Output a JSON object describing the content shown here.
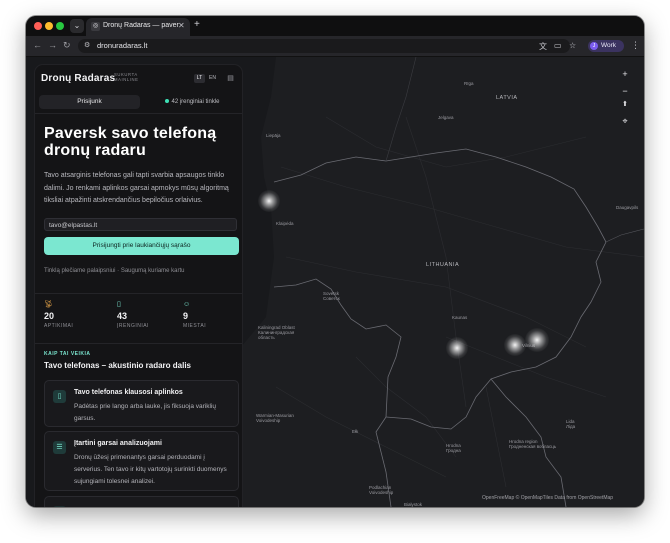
{
  "browser": {
    "tab_title": "Dronų Radaras — paversk sa...",
    "tab_favicon": "radar-favicon",
    "url": "dronuradaras.lt",
    "profile_initial": "J",
    "profile_label": "Work"
  },
  "panel": {
    "brand": "Dronų Radaras",
    "brand_sub_line1": "SUKURTA",
    "brand_sub_line2": "MAINLINE",
    "lang_lt": "LT",
    "lang_en": "EN",
    "login_label": "Prisijunk",
    "devices_label": "42 įrenginiai tinkle",
    "headline": "Paversk savo telefoną dronų radaru",
    "description": "Tavo atsarginis telefonas gali tapti svarbia apsaugos tinklo dalimi. Jo renkami aplinkos garsai apmokys mūsų algoritmą tiksliai atpažinti atskrendančius bepiločius orlaivius.",
    "email_placeholder": "tavo@elpastas.lt",
    "cta_label": "Prisijungti prie laukiančiųjų sąrašo",
    "note": "Tinklą plečiame palaipsniui · Saugumą kuriame kartu",
    "stats": [
      {
        "icon": "radar-icon",
        "value": "20",
        "label": "APTIKIMAI",
        "color": "#e8a64a"
      },
      {
        "icon": "phone-icon",
        "value": "43",
        "label": "ĮRENGINIAI",
        "color": "#7be7d0"
      },
      {
        "icon": "people-icon",
        "value": "9",
        "label": "MIESTAI",
        "color": "#7be7d0"
      }
    ],
    "kicker": "KAIP TAI VEIKIA",
    "section_title": "Tavo telefonas – akustinio radaro dalis",
    "steps": [
      {
        "icon": "phone-icon",
        "title": "Tavo telefonas klausosi aplinkos",
        "text": "Padėtas prie lango arba lauke, jis fiksuoja variklių garsus."
      },
      {
        "icon": "server-icon",
        "title": "Įtartini garsai analizuojami",
        "text": "Dronų ūžesį primenantys garsai perduodami į serverius. Ten tavo ir kitų vartotojų surinkti duomenys sujungiami tolesnei analizei."
      }
    ]
  },
  "map": {
    "labels": {
      "riga": "Rīga",
      "latvia": "LATVIA",
      "jelgava": "Jelgava",
      "liepaja": "Liepāja",
      "daugavpils": "Daugavpils",
      "klaipeda": "Klaipėda",
      "lithuania": "LITHUANIA",
      "sovetsk": "Sovetsk\nСоветск",
      "kaliningrad": "Kaliningrad Oblast\nКалининградская\nобласть",
      "kaunas": "Kaunas",
      "vilnius": "Vilnius",
      "warmian": "Warmian-Masurian\nVoivodeship",
      "lida": "Lida\nЛіда",
      "elk": "Ełk",
      "hrodna": "Hrodna\nГродна",
      "hrodna_region": "Hrodna region\nГродненская вобласць",
      "podlaskie": "Podlachian\nVoivodeship",
      "bialystok": "Białystok"
    },
    "attribution": "OpenFreeMap © OpenMapTiles Data from OpenStreetMap"
  }
}
